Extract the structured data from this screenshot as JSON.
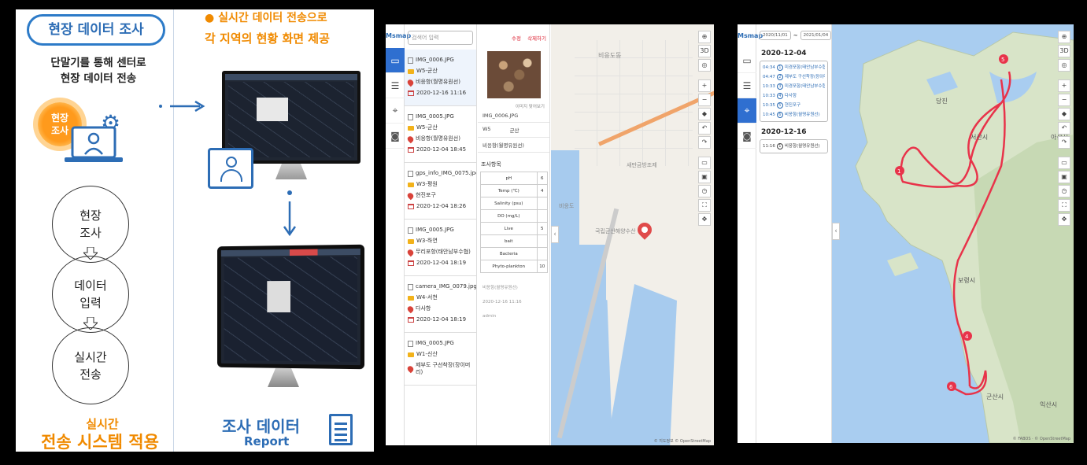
{
  "infographic": {
    "badge": "현장 데이터 조사",
    "lead": [
      "단말기를 통해 센터로",
      "현장 데이터 전송"
    ],
    "burst": [
      "현장",
      "조사"
    ],
    "steps": [
      [
        "현장",
        "조사"
      ],
      [
        "데이터",
        "입력"
      ],
      [
        "실시간",
        "전송"
      ]
    ],
    "realtime_line1": "● 실시간 데이터 전송으로",
    "realtime_line2": "각 지역의 현황 화면 제공",
    "bottom_sub": "실시간",
    "bottom_main": "전송 시스템 적용",
    "report_title": "조사 데이터",
    "report_sub": "Report",
    "colors": {
      "blue": "#2d6db5",
      "orange": "#f08a00"
    }
  },
  "app1": {
    "logo": "Msmap",
    "search_placeholder": "검색어 입력",
    "edit_label": "수정",
    "delete_label": "삭제하기",
    "list": [
      {
        "file": "IMG_0006.JPG",
        "group": "W5-군산",
        "place": "비응항(월명유원선)",
        "time": "2020-12-16 11:16",
        "selected": true
      },
      {
        "file": "IMG_0005.JPG",
        "group": "W5-군산",
        "place": "비응항(월명유원선)",
        "time": "2020-12-04 18:45",
        "selected": false
      },
      {
        "file": "gps_info_IMG_0075.jpg",
        "group": "W3-평원",
        "place": "현진포구",
        "time": "2020-12-04 18:26",
        "selected": false
      },
      {
        "file": "IMG_0005.JPG",
        "group": "W3-하연",
        "place": "무리포항(태안남부수협)",
        "time": "2020-12-04 18:19",
        "selected": false
      },
      {
        "file": "camera_IMG_0079.jpg",
        "group": "W4-서천",
        "place": "다사항",
        "time": "2020-12-04 18:19",
        "selected": false
      },
      {
        "file": "IMG_0005.JPG",
        "group": "W1-신산",
        "place": "제부도 구선착장(장이머리)",
        "time": "",
        "selected": false
      }
    ],
    "detail": {
      "photo_caption": "이미지 맞어보기",
      "filename": "IMG_0006.JPG",
      "group_code": "W5",
      "group_name": "군산",
      "place": "비응항(월명유원선)",
      "section_title": "조사항목",
      "measures": [
        {
          "name": "pH",
          "value": "6"
        },
        {
          "name": "Temp (℃)",
          "value": "4"
        },
        {
          "name": "Salinity (psu)",
          "value": ""
        },
        {
          "name": "DO (mg/L)",
          "value": ""
        },
        {
          "name": "Live",
          "value": "5"
        },
        {
          "name": "bait",
          "value": ""
        },
        {
          "name": "Bacteria",
          "value": ""
        },
        {
          "name": "Phyto-plankton",
          "value": "10"
        }
      ],
      "meta_place": "비응항(월명유원선)",
      "meta_time": "2020-12-16 11:16",
      "meta_user": "admin"
    },
    "map": {
      "labels": [
        "비응도동",
        "새만금방조제",
        "비응도",
        "국립군산해양수산"
      ],
      "attribution": "© 지도정보 © OpenStreetMap"
    },
    "tools": [
      "⊕",
      "3D",
      "◎",
      "+",
      "−",
      "◆",
      "↶",
      "↷",
      "▭",
      "▣",
      "◷",
      "⛶",
      "✥"
    ]
  },
  "app2": {
    "logo": "Msmap",
    "date_from": "2020/11/01",
    "date_sep": "~",
    "date_to": "2021/01/04",
    "days": [
      {
        "date": "2020-12-04",
        "stops": [
          {
            "time": "04:34",
            "n": "1",
            "name": "미경포항(태안남부수협)"
          },
          {
            "time": "04:47",
            "n": "2",
            "name": "제부도 구선착장(장이머리)"
          },
          {
            "time": "10:33",
            "n": "3",
            "name": "미경포항(태안남부수협)"
          },
          {
            "time": "10:33",
            "n": "4",
            "name": "다사항"
          },
          {
            "time": "10:35",
            "n": "5",
            "name": "현진포구"
          },
          {
            "time": "10:45",
            "n": "6",
            "name": "비응항(월명유원선)"
          }
        ]
      },
      {
        "date": "2020-12-16",
        "stops": [
          {
            "time": "11:16",
            "n": "1",
            "name": "비응항(월명유원선)"
          }
        ]
      }
    ],
    "map": {
      "labels": [
        "당진",
        "서산시",
        "아산시",
        "보령시",
        "군산시",
        "익산시"
      ],
      "route_markers": [
        "1",
        "4",
        "5",
        "6"
      ],
      "attribution": "© FABOS · © OpenStreetMap"
    },
    "route_color": "#e8334a"
  }
}
